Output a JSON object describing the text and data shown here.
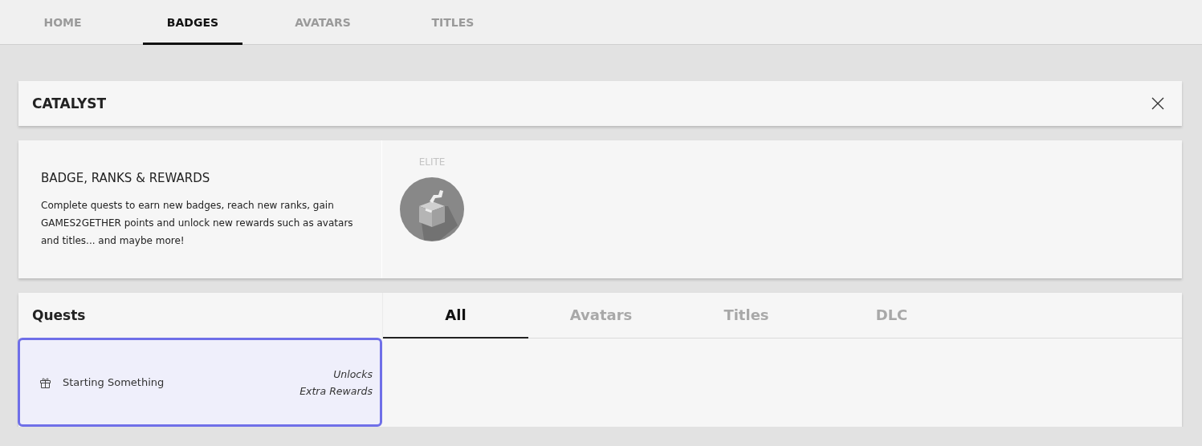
{
  "nav_tabs": [
    {
      "label": "HOME",
      "selected": false
    },
    {
      "label": "BADGES",
      "selected": true
    },
    {
      "label": "AVATARS",
      "selected": false
    },
    {
      "label": "TITLES",
      "selected": false
    }
  ],
  "panel": {
    "title": "CATALYST"
  },
  "info": {
    "heading": "BADGE, RANKS & REWARDS",
    "text": "Complete quests to earn new badges, reach new ranks, gain GAMES2GETHER points and unlock new rewards such as avatars and titles... and maybe more!"
  },
  "badges": [
    {
      "label": "ELITE"
    }
  ],
  "quests": {
    "title": "Quests",
    "items": [
      {
        "name": "Starting Something",
        "reward_lines": [
          "Unlocks",
          "Extra Rewards"
        ],
        "selected": true
      }
    ]
  },
  "filter_tabs": [
    {
      "label": "All",
      "selected": true
    },
    {
      "label": "Avatars",
      "selected": false
    },
    {
      "label": "Titles",
      "selected": false
    },
    {
      "label": "DLC",
      "selected": false
    }
  ]
}
